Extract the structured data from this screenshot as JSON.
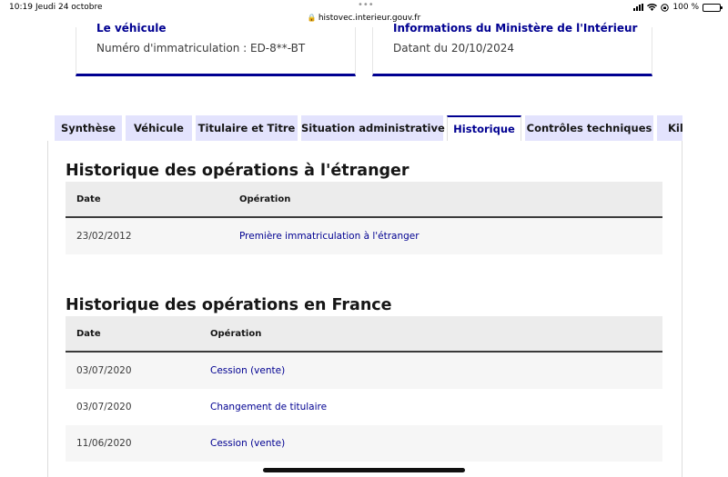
{
  "status_bar": {
    "time": "10:19",
    "date": "Jeudi 24 octobre",
    "dots": "•••",
    "url": "histovec.interieur.gouv.fr",
    "battery": "100 %"
  },
  "cards": {
    "vehicle": {
      "title": "Le véhicule",
      "text": "Numéro d'immatriculation : ED-8**-BT"
    },
    "ministry": {
      "title": "Informations du Ministère de l'Intérieur",
      "text": "Datant du 20/10/2024"
    }
  },
  "tabs": [
    {
      "label": "Synthèse",
      "active": false
    },
    {
      "label": "Véhicule",
      "active": false
    },
    {
      "label": "Titulaire et Titre",
      "active": false
    },
    {
      "label": "Situation administrative",
      "active": false
    },
    {
      "label": "Historique",
      "active": true
    },
    {
      "label": "Contrôles techniques",
      "active": false
    },
    {
      "label": "Kilo",
      "active": false
    }
  ],
  "foreign_history": {
    "title": "Historique des opérations à l'étranger",
    "columns": [
      "Date",
      "Opération"
    ],
    "rows": [
      {
        "date": "23/02/2012",
        "operation": "Première immatriculation à l'étranger"
      }
    ]
  },
  "france_history": {
    "title": "Historique des opérations en France",
    "columns": [
      "Date",
      "Opération"
    ],
    "rows": [
      {
        "date": "03/07/2020",
        "operation": "Cession (vente)"
      },
      {
        "date": "03/07/2020",
        "operation": "Changement de titulaire"
      },
      {
        "date": "11/06/2020",
        "operation": "Cession (vente)"
      }
    ]
  },
  "colors": {
    "accent": "#000091",
    "tab_bg": "#e3e3fd",
    "row_alt": "#f6f6f6"
  }
}
